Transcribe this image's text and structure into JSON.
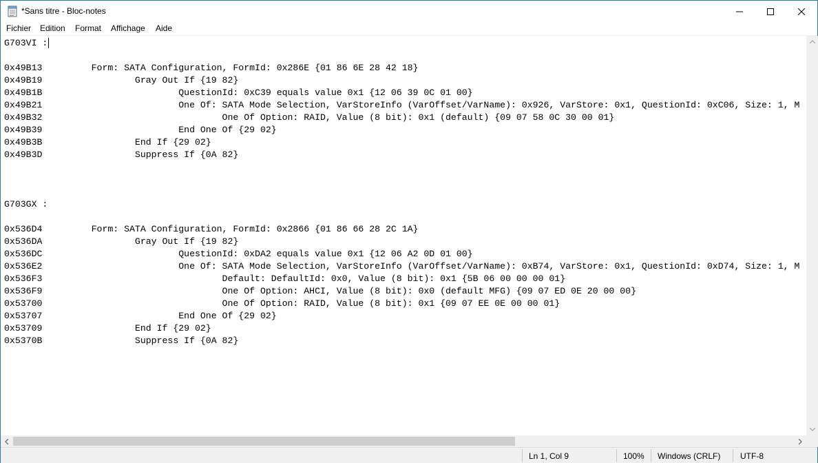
{
  "window": {
    "title": "*Sans titre - Bloc-notes",
    "icon": "notepad-icon",
    "buttons": [
      "minimize-icon",
      "maximize-icon",
      "close-icon"
    ]
  },
  "menu": {
    "items": [
      "Fichier",
      "Edition",
      "Format",
      "Affichage",
      "Aide"
    ]
  },
  "editor": {
    "lines": [
      "G703VI :",
      "",
      "0x49B13         Form: SATA Configuration, FormId: 0x286E {01 86 6E 28 42 18}",
      "0x49B19                 Gray Out If {19 82}",
      "0x49B1B                         QuestionId: 0xC39 equals value 0x1 {12 06 39 0C 01 00}",
      "0x49B21                         One Of: SATA Mode Selection, VarStoreInfo (VarOffset/VarName): 0x926, VarStore: 0x1, QuestionId: 0xC06, Size: 1, M",
      "0x49B32                                 One Of Option: RAID, Value (8 bit): 0x1 (default) {09 07 58 0C 30 00 01}",
      "0x49B39                         End One Of {29 02}",
      "0x49B3B                 End If {29 02}",
      "0x49B3D                 Suppress If {0A 82}",
      "",
      "",
      "",
      "G703GX :",
      "",
      "0x536D4         Form: SATA Configuration, FormId: 0x2866 {01 86 66 28 2C 1A}",
      "0x536DA                 Gray Out If {19 82}",
      "0x536DC                         QuestionId: 0xDA2 equals value 0x1 {12 06 A2 0D 01 00}",
      "0x536E2                         One Of: SATA Mode Selection, VarStoreInfo (VarOffset/VarName): 0xB74, VarStore: 0x1, QuestionId: 0xD74, Size: 1, M",
      "0x536F3                                 Default: DefaultId: 0x0, Value (8 bit): 0x1 {5B 06 00 00 00 01}",
      "0x536F9                                 One Of Option: AHCI, Value (8 bit): 0x0 (default MFG) {09 07 ED 0E 20 00 00}",
      "0x53700                                 One Of Option: RAID, Value (8 bit): 0x1 {09 07 EE 0E 00 00 01}",
      "0x53707                         End One Of {29 02}",
      "0x53709                 End If {29 02}",
      "0x5370B                 Suppress If {0A 82}"
    ]
  },
  "scrollbars": {
    "horizontal_position": 0.0,
    "horizontal_visible_fraction": 0.62
  },
  "status": {
    "position": "Ln 1, Col 9",
    "zoom": "100%",
    "line_ending": "Windows (CRLF)",
    "encoding": "UTF-8"
  },
  "colors": {
    "window_border": "#2b7aa8",
    "chrome": "#f0f0f0",
    "scroll_thumb": "#cdcdcd"
  }
}
